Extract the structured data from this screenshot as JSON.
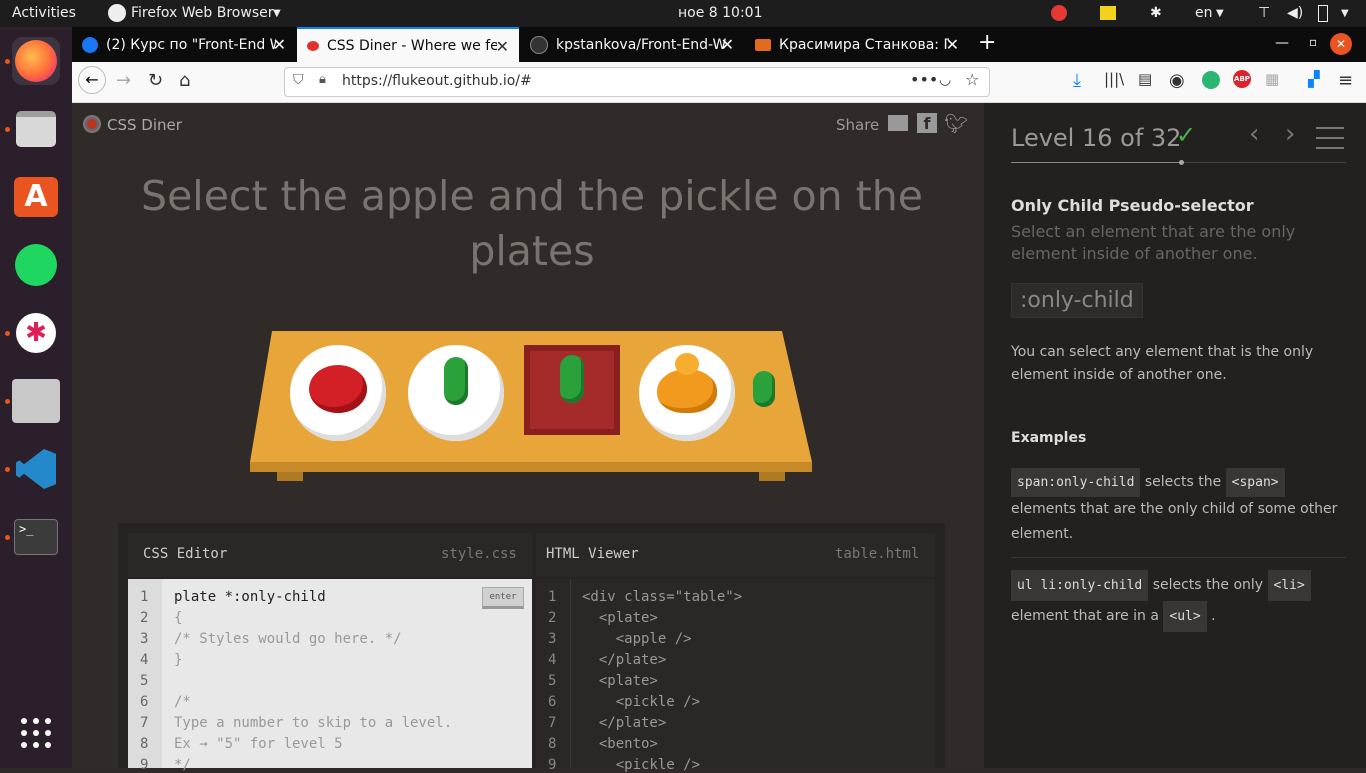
{
  "system": {
    "activities": "Activities",
    "app_menu": "Firefox Web Browser",
    "clock": "ное 8  10:01",
    "lang": "en"
  },
  "tabs": [
    {
      "title": "(2) Курс по \"Front-End W",
      "icon_color": "#1877f2"
    },
    {
      "title": "CSS Diner - Where we fe",
      "icon_color": "#e0322b"
    },
    {
      "title": "kpstankova/Front-End-W",
      "icon_color": "#333333"
    },
    {
      "title": "Красимира Станкова: Пр",
      "icon_color": "#e36b1f"
    }
  ],
  "url": "https://flukeout.github.io/#",
  "site": {
    "logo_text": "CSS Diner",
    "share": "Share",
    "instruction": "Select the apple and the pickle on the plates",
    "editor_title": "CSS Editor",
    "editor_file": "style.css",
    "viewer_title": "HTML Viewer",
    "viewer_file": "table.html",
    "enter": "enter",
    "css_lines": [
      "plate *:only-child",
      "{",
      "/* Styles would go here. */",
      "}",
      "",
      "/*",
      "Type a number to skip to a level.",
      "Ex → \"5\" for level 5",
      "*/"
    ],
    "html_lines": [
      "<div class=\"table\">",
      "  <plate>",
      "    <apple />",
      "  </plate>",
      "  <plate>",
      "    <pickle />",
      "  </plate>",
      "  <bento>",
      "    <pickle />"
    ],
    "line_numbers": [
      "1",
      "2",
      "3",
      "4",
      "5",
      "6",
      "7",
      "8",
      "9"
    ]
  },
  "sidebar": {
    "level": "Level 16 of 32",
    "heading": "Only Child Pseudo-selector",
    "subheading": "Select an element that are the only element inside of another one.",
    "selector": ":only-child",
    "description": "You can select any element that is the only element inside of another one.",
    "examples_title": "Examples",
    "ex1_code": "span:only-child",
    "ex1_text1": "selects the",
    "ex1_code2": "<span>",
    "ex1_text2": "elements that are the only child of some other element.",
    "ex2_code": "ul li:only-child",
    "ex2_text1": "selects the only",
    "ex2_code2": "<li>",
    "ex2_text2": "element that are in a",
    "ex2_code3": "<ul>",
    "ex2_text3": "."
  },
  "colors": {
    "accent": "#0a84ff",
    "check": "#4cb050",
    "table": "#e8a53a"
  }
}
